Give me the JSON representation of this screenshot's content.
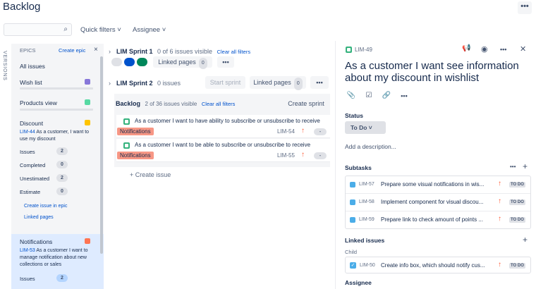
{
  "header": {
    "title": "Backlog",
    "more_label": "•••"
  },
  "toolbar": {
    "search_placeholder": "",
    "quick_filters": "Quick filters ˅",
    "assignee": "Assignee ˅"
  },
  "sidebar": {
    "versions_label": "VERSIONS",
    "epics_label": "EPICS",
    "create_epic": "Create epic",
    "close": "×",
    "all_issues": "All issues",
    "epics": [
      {
        "name": "Wish list",
        "color": "#8777d9"
      },
      {
        "name": "Products view",
        "color": "#57d9a3"
      },
      {
        "name": "Discount",
        "color": "#ffc400"
      }
    ],
    "discount_detail": {
      "key": "LIM-44",
      "summary": "As a customer, I want to use my discount",
      "stats": [
        {
          "label": "Issues",
          "value": "2"
        },
        {
          "label": "Completed",
          "value": "0"
        },
        {
          "label": "Unestimated",
          "value": "2"
        },
        {
          "label": "Estimate",
          "value": "0"
        }
      ],
      "create_issue_link": "Create issue in epic",
      "linked_pages_link": "Linked pages"
    },
    "notifications": {
      "name": "Notifications",
      "color": "#ff7452",
      "key": "LIM-53",
      "summary": "As a customer I want to manage notification about new collections or sales",
      "issues_label": "Issues",
      "issues_value": "2"
    }
  },
  "sprint1": {
    "name": "LIM Sprint 1",
    "visible": "0 of 6 issues visible",
    "clear": "Clear all filters",
    "linked_pages": "Linked pages",
    "linked_count": "0",
    "more": "•••"
  },
  "sprint2": {
    "name": "LIM Sprint 2",
    "count": "0 issues",
    "start": "Start sprint",
    "linked_pages": "Linked pages",
    "linked_count": "0",
    "more": "•••"
  },
  "backlog": {
    "name": "Backlog",
    "visible": "2 of 36 issues visible",
    "clear": "Clear all filters",
    "create_sprint": "Create sprint",
    "issues": [
      {
        "summary": "As a customer I want to have ability to subscribe or unsubscribe to receive",
        "epic": "Notifications",
        "key": "LIM-54",
        "estimate": "-"
      },
      {
        "summary": "As a customer I want to be able to subscribe or unsubscribe to receive",
        "epic": "Notifications",
        "key": "LIM-55",
        "estimate": "-"
      }
    ],
    "create_issue": "+ Create issue"
  },
  "detail": {
    "key": "LIM-49",
    "title": "As a customer I want see information about my discount in wishlist",
    "status_label": "Status",
    "status_value": "To Do ˅",
    "add_description": "Add a description...",
    "subtasks_label": "Subtasks",
    "subtasks": [
      {
        "key": "LIM-57",
        "summary": "Prepare some visual notifications in wis...",
        "status": "TO DO"
      },
      {
        "key": "LIM-58",
        "summary": "Implement component for visual discou...",
        "status": "TO DO"
      },
      {
        "key": "LIM-59",
        "summary": "Prepare link to check amount of points ...",
        "status": "TO DO"
      }
    ],
    "linked_label": "Linked issues",
    "child_label": "Child",
    "linked": {
      "key": "LIM-50",
      "summary": "Create info box, which should notify cus...",
      "status": "TO DO"
    },
    "assignee_label": "Assignee"
  },
  "icons": {
    "search": "⌕",
    "announce": "📢",
    "watch": "◉",
    "more": "•••",
    "close": "✕",
    "attach": "📎",
    "checklist": "☑",
    "link": "🔗",
    "plus": "+",
    "ellipsis": "•••",
    "chevron": "›",
    "prio": "↑",
    "check": "✓"
  }
}
